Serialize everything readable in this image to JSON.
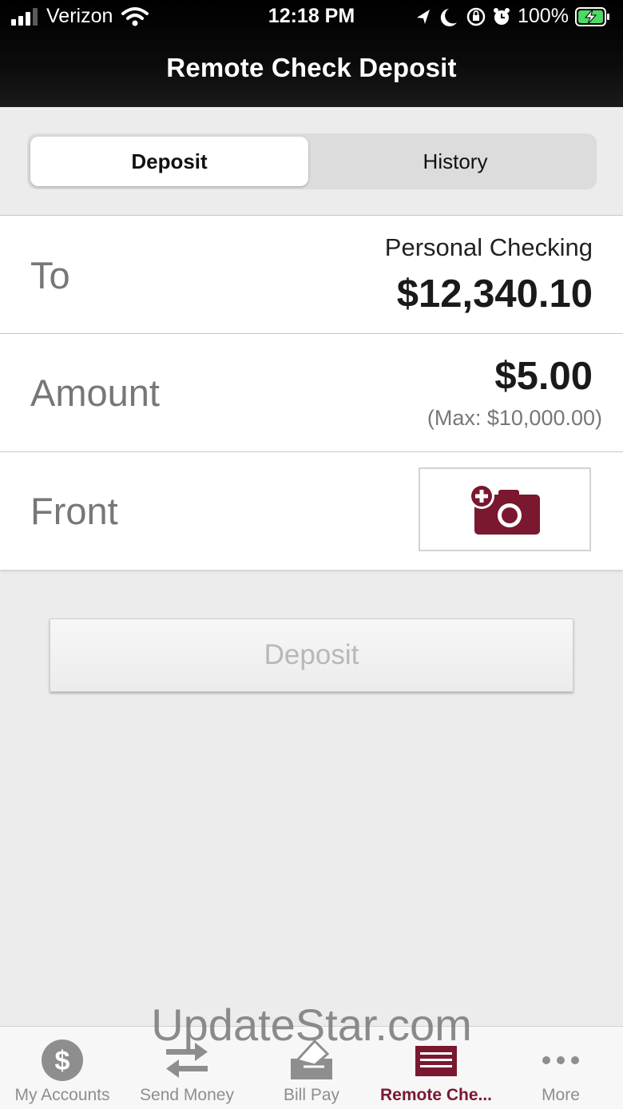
{
  "status_bar": {
    "carrier": "Verizon",
    "time": "12:18 PM",
    "battery": "100%"
  },
  "nav": {
    "title": "Remote Check Deposit"
  },
  "segments": {
    "deposit": "Deposit",
    "history": "History"
  },
  "form": {
    "to_label": "To",
    "account_name": "Personal Checking",
    "account_balance": "$12,340.10",
    "amount_label": "Amount",
    "amount_value": "$5.00",
    "amount_max": "(Max: $10,000.00)",
    "front_label": "Front"
  },
  "deposit_button": "Deposit",
  "watermark": "UpdateStar.com",
  "tabs": [
    {
      "label": "My Accounts",
      "icon": "dollar-icon"
    },
    {
      "label": "Send Money",
      "icon": "transfer-icon"
    },
    {
      "label": "Bill Pay",
      "icon": "bill-pay-icon"
    },
    {
      "label": "Remote Che...",
      "icon": "check-icon"
    },
    {
      "label": "More",
      "icon": "more-icon"
    }
  ],
  "colors": {
    "accent": "#7a1830",
    "header_bg": "#000000",
    "tab_inactive": "#8e8e8e"
  }
}
